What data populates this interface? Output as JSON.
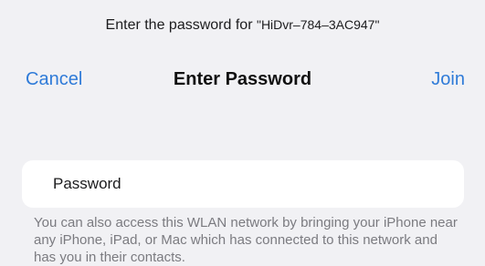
{
  "prompt": {
    "text": "Enter the password for",
    "network_name": "\"HiDvr–784–3AC947\""
  },
  "navbar": {
    "cancel_label": "Cancel",
    "title": "Enter Password",
    "join_label": "Join"
  },
  "password_field": {
    "placeholder": "Password",
    "value": ""
  },
  "help_text": "You can also access this WLAN network by bringing your iPhone near any iPhone, iPad, or Mac which has connected to this network and has you in their contacts.",
  "colors": {
    "accent": "#2f7bd8",
    "background": "#f1f1f4",
    "card": "#ffffff",
    "secondary_text": "#7b7b80"
  }
}
